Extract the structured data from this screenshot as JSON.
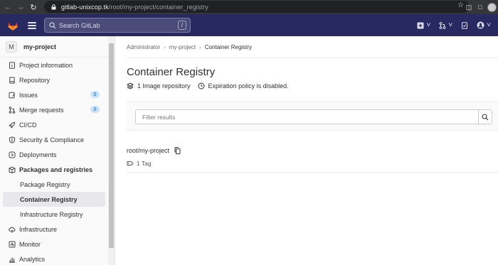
{
  "browser": {
    "url_host": "gitlab-unixcop.tk",
    "url_path": "/root/my-project/container_registry"
  },
  "header": {
    "search_placeholder": "Search GitLab",
    "search_shortcut": "/"
  },
  "sidebar": {
    "project_avatar": "M",
    "project_name": "my-project",
    "items": [
      {
        "label": "Project information",
        "icon": "info-icon"
      },
      {
        "label": "Repository",
        "icon": "book-icon"
      },
      {
        "label": "Issues",
        "icon": "issues-icon",
        "badge": "0"
      },
      {
        "label": "Merge requests",
        "icon": "merge-request-icon",
        "badge": "0"
      },
      {
        "label": "CI/CD",
        "icon": "rocket-icon"
      },
      {
        "label": "Security & Compliance",
        "icon": "shield-icon"
      },
      {
        "label": "Deployments",
        "icon": "deployments-icon"
      },
      {
        "label": "Packages and registries",
        "icon": "package-icon"
      },
      {
        "label": "Package Registry"
      },
      {
        "label": "Container Registry",
        "active": true
      },
      {
        "label": "Infrastructure Registry"
      },
      {
        "label": "Infrastructure",
        "icon": "cloud-gear-icon"
      },
      {
        "label": "Monitor",
        "icon": "monitor-icon"
      },
      {
        "label": "Analytics",
        "icon": "chart-icon"
      }
    ]
  },
  "breadcrumb": [
    "Administrator",
    "my-project",
    "Container Registry"
  ],
  "page": {
    "title": "Container Registry",
    "image_count": "1 Image repository",
    "expiration": "Expiration policy is disabled."
  },
  "filter": {
    "placeholder": "Filter results"
  },
  "repositories": [
    {
      "name": "root/my-project",
      "tags": "1 Tag"
    }
  ],
  "colors": {
    "header_bg": "#292961",
    "browser_bar": "#35363a",
    "badge_bg": "#cbe2f9"
  }
}
